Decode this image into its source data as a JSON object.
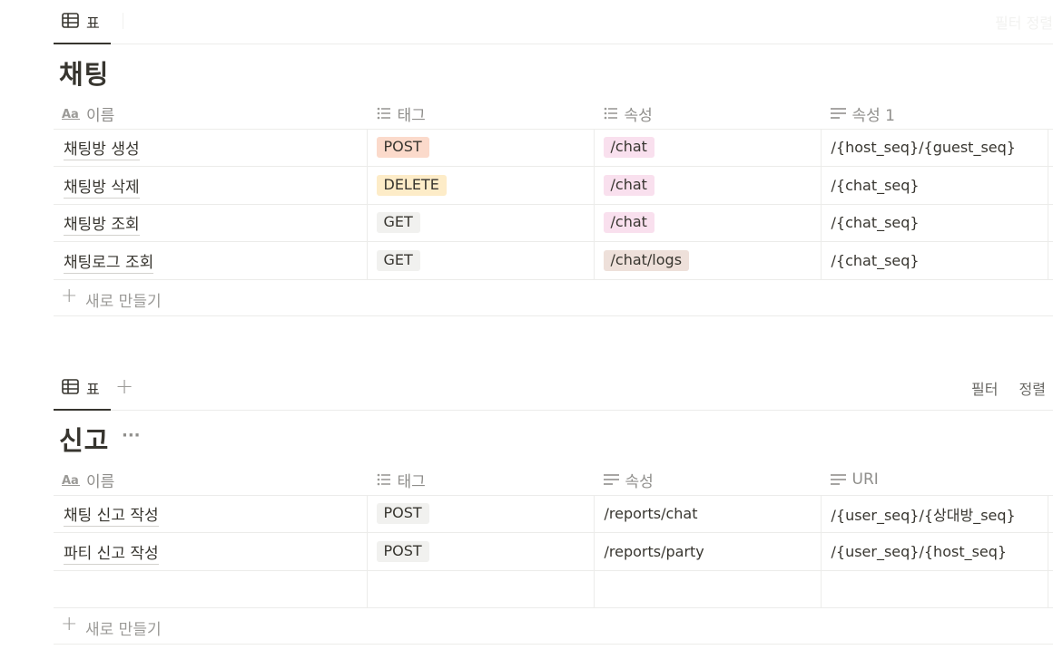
{
  "sections": [
    {
      "view_tab": "표",
      "title": "채팅",
      "faint_actions": "필터 정렬",
      "columns": [
        "이름",
        "태그",
        "속성",
        "속성 1"
      ],
      "rows": [
        {
          "name": "채팅방 생성",
          "tag": "POST",
          "prop": "/chat",
          "prop1": "/{host_seq}/{guest_seq}"
        },
        {
          "name": "채팅방 삭제",
          "tag": "DELETE",
          "prop": "/chat",
          "prop1": "/{chat_seq}"
        },
        {
          "name": "채팅방 조회",
          "tag": "GET",
          "prop": "/chat",
          "prop1": "/{chat_seq}"
        },
        {
          "name": "채팅로그 조회",
          "tag": "GET",
          "prop": "/chat/logs",
          "prop1": "/{chat_seq}"
        }
      ],
      "new_label": "새로 만들기"
    },
    {
      "view_tab": "표",
      "add_view": "+",
      "title": "신고",
      "more": "···",
      "filter_label": "필터",
      "sort_label": "정렬",
      "columns": [
        "이름",
        "태그",
        "속성",
        "URI"
      ],
      "rows": [
        {
          "name": "채팅 신고 작성",
          "tag": "POST",
          "prop": "/reports/chat",
          "uri": "/{user_seq}/{상대방_seq}"
        },
        {
          "name": "파티 신고 작성",
          "tag": "POST",
          "prop": "/reports/party",
          "uri": "/{user_seq}/{host_seq}"
        }
      ],
      "new_label": "새로 만들기"
    }
  ],
  "colors": {
    "tag_post": "#fbdacb",
    "tag_delete": "#fdecc8",
    "tag_get": "#f1f1ef",
    "prop_chat": "#f9e0ee",
    "prop_chat_logs": "#eee0da",
    "tag_post_text": "#37352f"
  },
  "icons": {
    "table_view": "table-icon",
    "title_prop": "aa-title-icon",
    "multi_select": "list-icon",
    "text_prop": "text-lines-icon",
    "plus": "plus-icon"
  }
}
